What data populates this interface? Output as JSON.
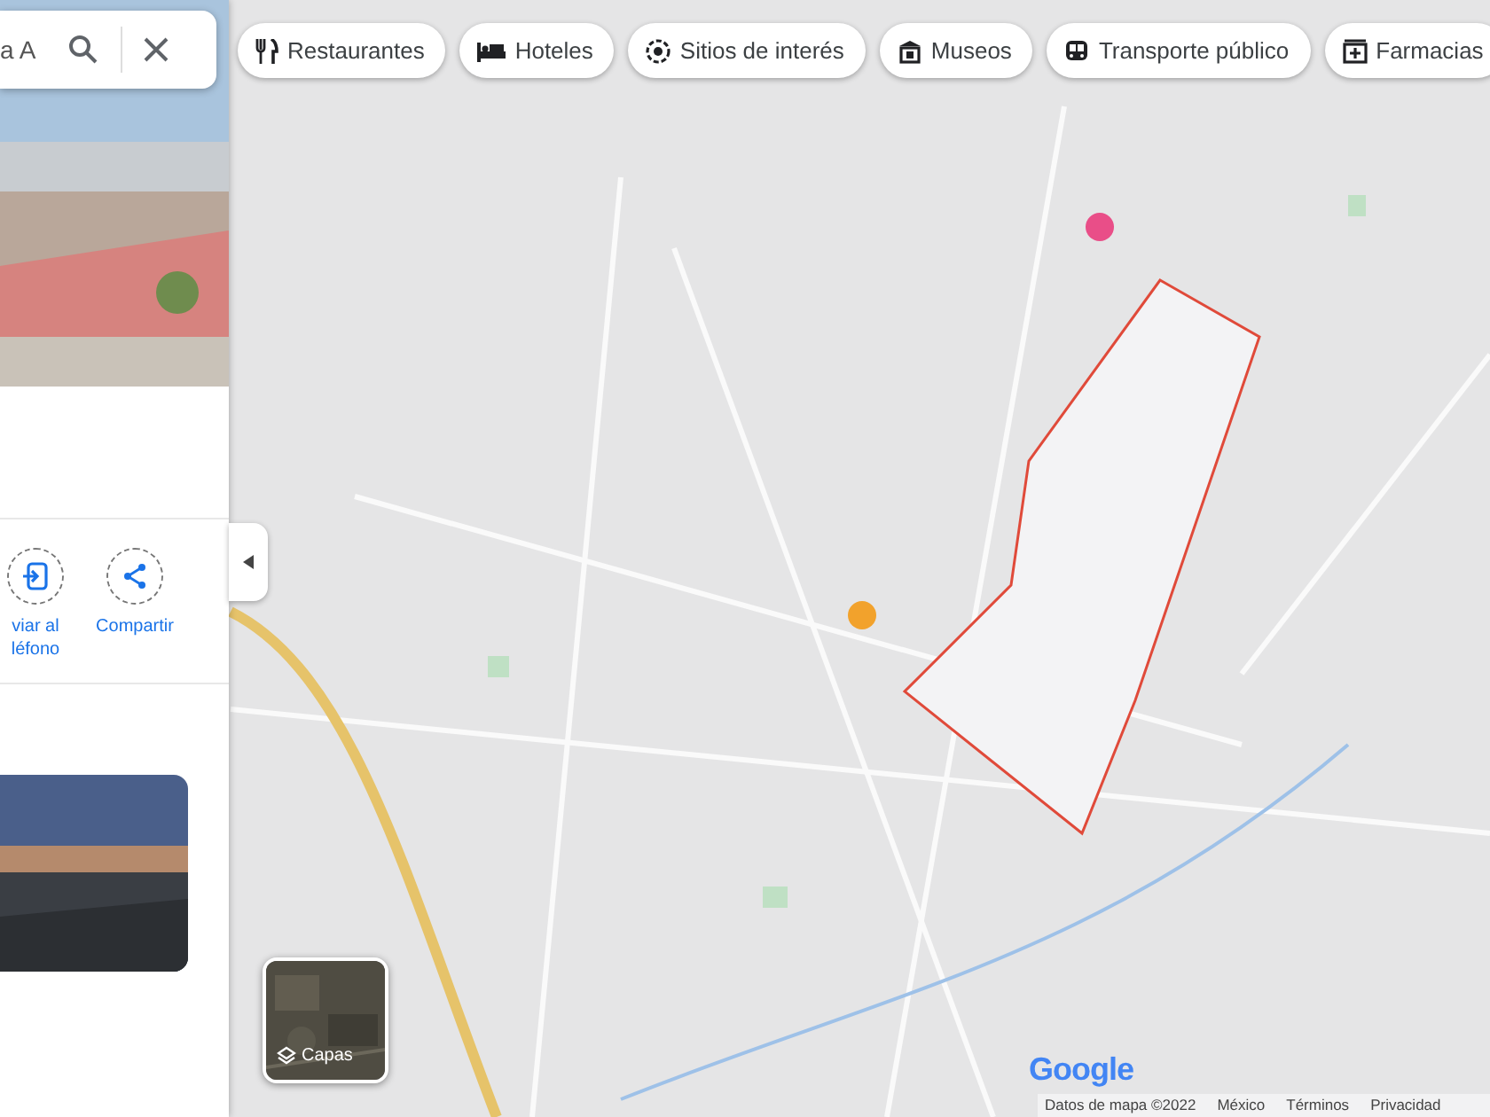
{
  "search": {
    "value": "a A"
  },
  "chips": [
    {
      "label": "Restaurantes"
    },
    {
      "label": "Hoteles"
    },
    {
      "label": "Sitios de interés"
    },
    {
      "label": "Museos"
    },
    {
      "label": "Transporte público"
    },
    {
      "label": "Farmacias"
    }
  ],
  "actions": [
    {
      "label": "viar al léfono"
    },
    {
      "label": "Compartir"
    }
  ],
  "layers": {
    "label": "Capas"
  },
  "footer": {
    "logo": "Google",
    "items": [
      "Datos de mapa ©2022",
      "México",
      "Términos",
      "Privacidad"
    ]
  }
}
